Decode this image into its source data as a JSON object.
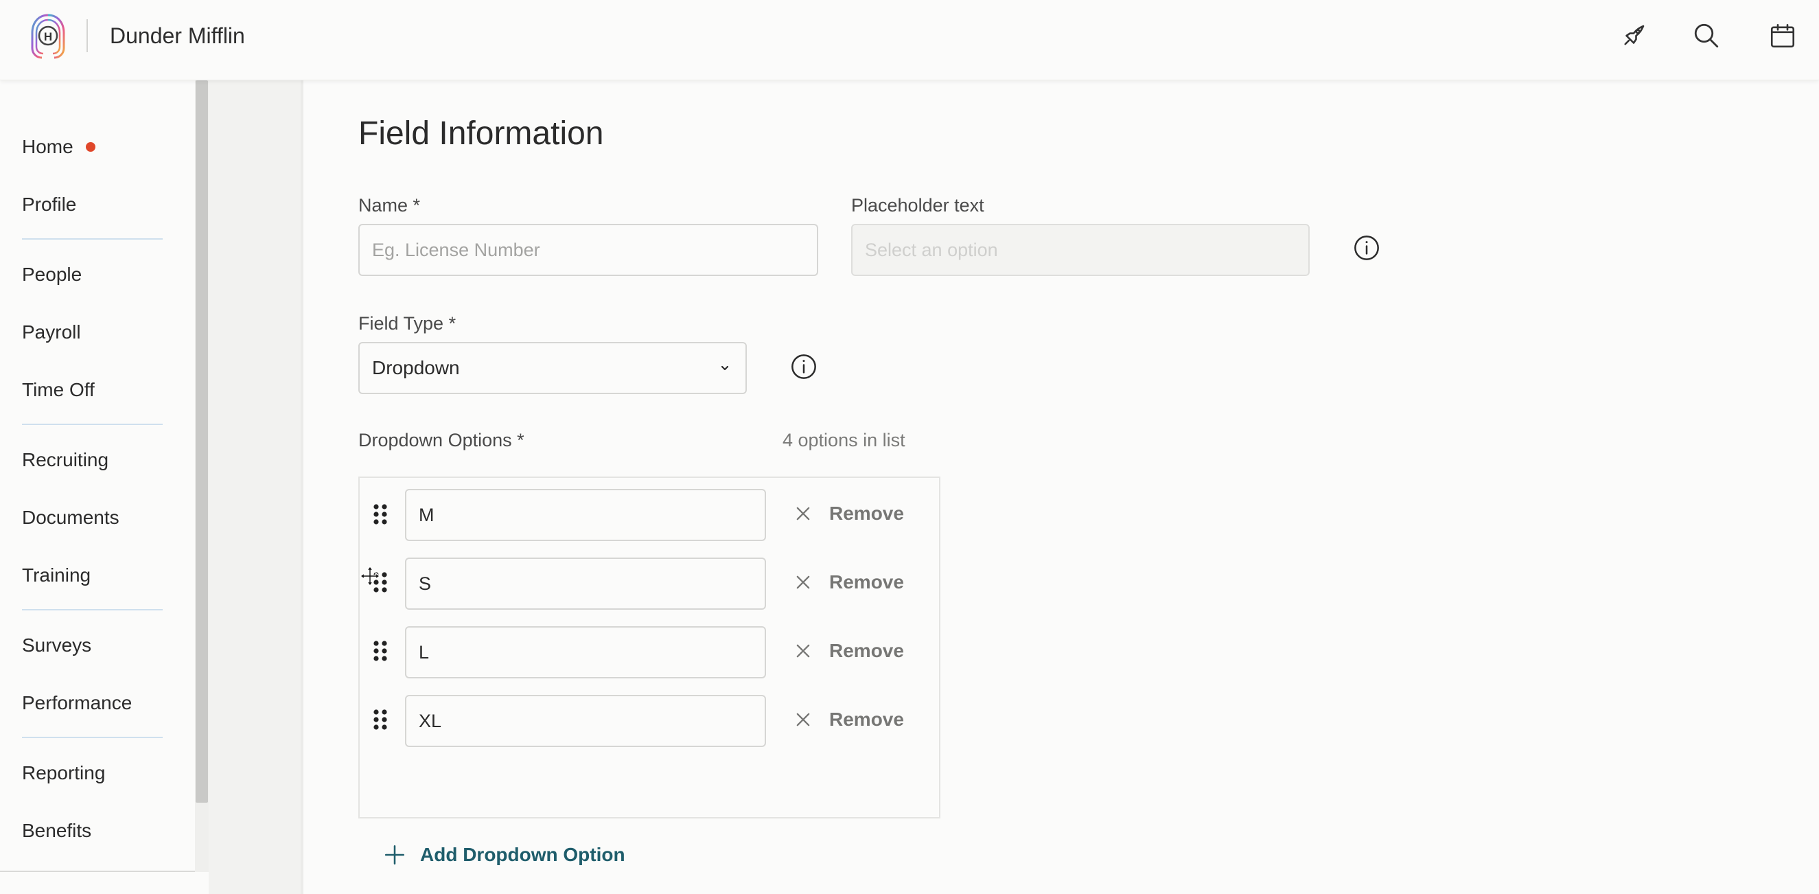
{
  "header": {
    "company_name": "Dunder Mifflin",
    "icons": [
      "rocket-icon",
      "search-icon",
      "calendar-icon"
    ]
  },
  "sidebar": {
    "items": [
      {
        "label": "Home",
        "notification_dot": true
      },
      {
        "label": "Profile"
      },
      {
        "label": "People"
      },
      {
        "label": "Payroll"
      },
      {
        "label": "Time Off"
      },
      {
        "label": "Recruiting"
      },
      {
        "label": "Documents"
      },
      {
        "label": "Training"
      },
      {
        "label": "Surveys"
      },
      {
        "label": "Performance"
      },
      {
        "label": "Reporting"
      },
      {
        "label": "Benefits"
      }
    ],
    "notification_color": "#e0472a"
  },
  "form": {
    "title": "Field Information",
    "name": {
      "label": "Name *",
      "placeholder": "Eg. License Number",
      "value": ""
    },
    "placeholder_text": {
      "label": "Placeholder text",
      "placeholder": "Select an option",
      "disabled": true
    },
    "field_type": {
      "label": "Field Type *",
      "value": "Dropdown"
    },
    "dropdown_options": {
      "label": "Dropdown Options *",
      "count_text": "4 options in list",
      "options": [
        "M",
        "S",
        "L",
        "XL"
      ],
      "remove_label": "Remove",
      "add_label": "Add Dropdown Option"
    }
  },
  "colors": {
    "accent": "#1f5d6b",
    "remove_text": "#767674",
    "divider": "#cfe0ee"
  }
}
